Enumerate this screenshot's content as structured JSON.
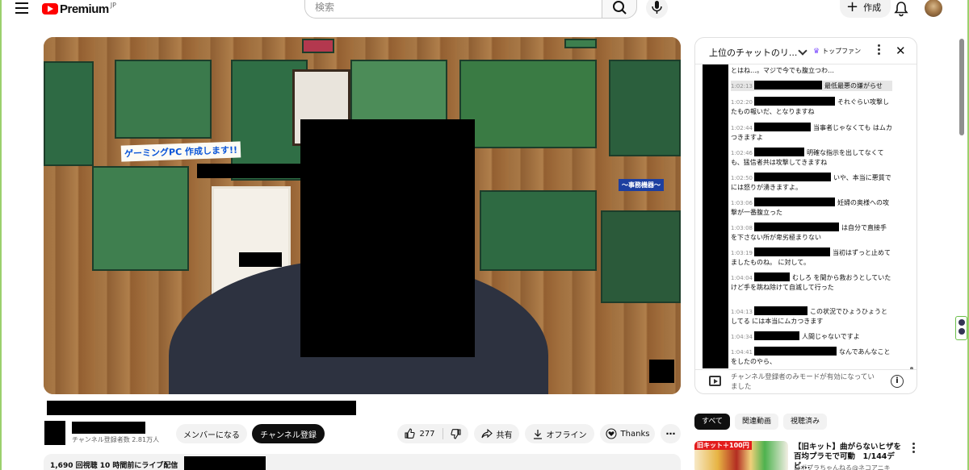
{
  "header": {
    "logo_text": "Premium",
    "search_placeholder": "検索",
    "create_label": "作成"
  },
  "video": {
    "wall_sign": "ゲーミングPC 作成します!!",
    "wall_sign2": "〜事務機器〜"
  },
  "channel": {
    "subscribers": "チャンネル登録者数 2.81万人",
    "member_button": "メンバーになる",
    "subscribe_button": "チャンネル登録"
  },
  "actions": {
    "like_count": "277",
    "share": "共有",
    "offline": "オフライン",
    "thanks": "Thanks"
  },
  "description": {
    "meta": "1,690 回視聴  10 時間前にライブ配信"
  },
  "chat": {
    "title": "上位のチャットのリ...",
    "topfan": "トップファン",
    "messages": [
      {
        "ts": "",
        "text": "とはね…。マジで今でも腹立つわ…"
      },
      {
        "ts": "1:02:13",
        "text": "最低最悪の嫌がらせ"
      },
      {
        "ts": "1:02:20",
        "text": "それぐらい攻撃したもの報いだ、となりますね"
      },
      {
        "ts": "1:02:44",
        "text": "当事者じゃなくても        はムカつきますよ"
      },
      {
        "ts": "1:02:46",
        "text": "明確な指示を出してなくても、猛信者共は攻撃してきますね"
      },
      {
        "ts": "1:02:50",
        "text": "いや、本当に悪質で        には怒りが湧きますよ。"
      },
      {
        "ts": "1:03:06",
        "text": "妊婦の奥様への攻撃が一番腹立った"
      },
      {
        "ts": "1:03:08",
        "text": "は自分で直接手を下さない所が卑劣極まりない"
      },
      {
        "ts": "1:03:19",
        "text": "当初はずっと止めてましたものね。    に対して。"
      },
      {
        "ts": "1:04:04",
        "text": "むしろ        を間から救おうとしていた けど手を跳ね除けて自滅して行った"
      },
      {
        "ts": "1:04:13",
        "text": "この状況でひょうひょうとしてる        には本当にムカつきます"
      },
      {
        "ts": "1:04:34",
        "text": "人間じゃないですよ"
      },
      {
        "ts": "1:04:41",
        "text": "なんであんなことをしたのやら、"
      }
    ],
    "footer_text": "チャンネル登録者のみモードが有効になっていました"
  },
  "chips": [
    "すべて",
    "関連動画",
    "視聴済み"
  ],
  "recommendation": {
    "badge": "旧キット＋100円",
    "title": "【旧キット】曲がらないヒザを百均プラモで可動　1/144デビ...",
    "channel": "ロボプラちゃんねる@ネコアニキ"
  }
}
